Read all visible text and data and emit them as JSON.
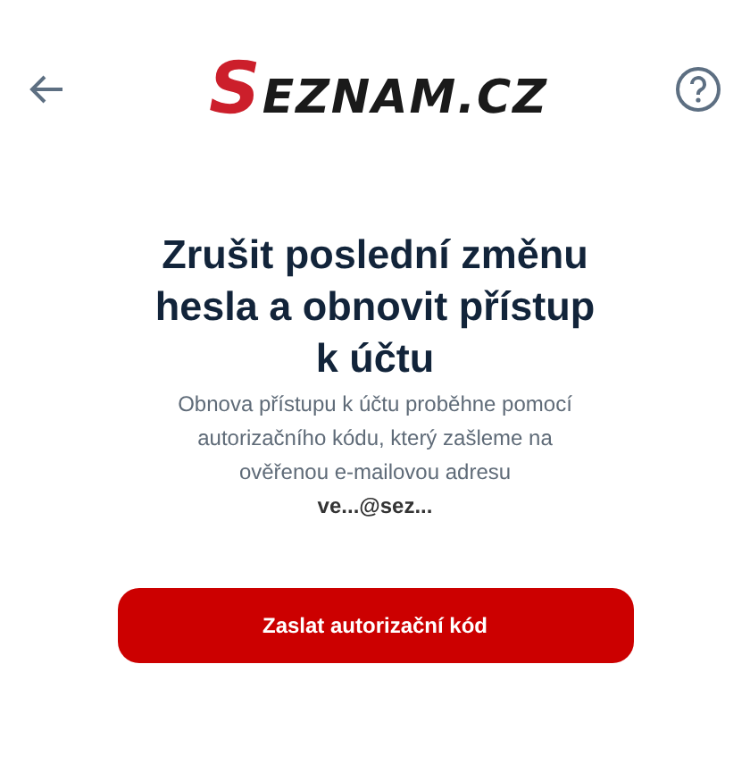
{
  "header": {
    "logo": "SEZNAM.CZ"
  },
  "title": "Zrušit poslední změnu hesla a obnovit přístup k účtu",
  "description": "Obnova přístupu k účtu proběhne pomocí autorizačního kódu, který zašleme na ověřenou e-mailovou adresu\n**ve...@sez...**",
  "button": {
    "label": "Zaslat autorizační kód"
  }
}
